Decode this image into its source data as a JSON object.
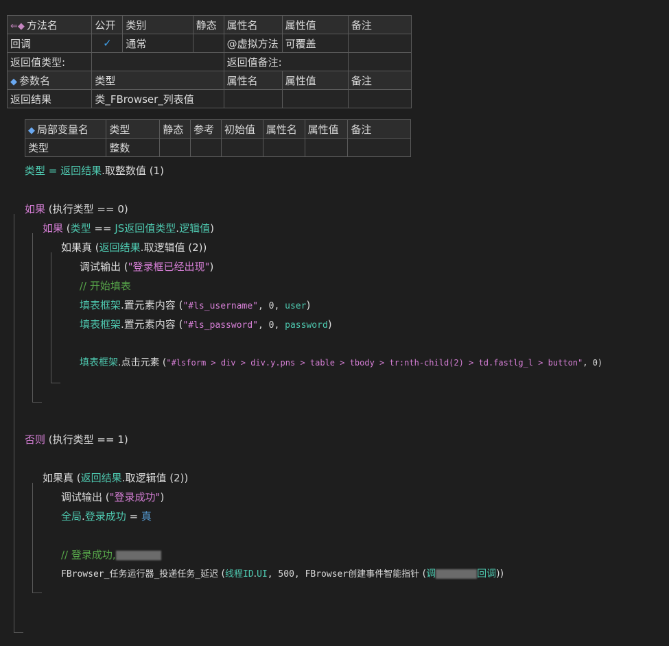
{
  "method_table": {
    "headers": [
      "方法名",
      "公开",
      "类别",
      "静态",
      "属性名",
      "属性值",
      "备注"
    ],
    "row": {
      "name": "回调",
      "public_check": "✓",
      "category": "通常",
      "attr_name": "@虚拟方法",
      "attr_value": "可覆盖"
    },
    "return_type_label": "返回值类型:",
    "return_note_label": "返回值备注:",
    "param_headers": [
      "参数名",
      "类型",
      "属性名",
      "属性值",
      "备注"
    ],
    "param_row": {
      "name": "返回结果",
      "type": "类_FBrowser_列表值"
    }
  },
  "local_table": {
    "headers": [
      "局部变量名",
      "类型",
      "静态",
      "参考",
      "初始值",
      "属性名",
      "属性值",
      "备注"
    ],
    "row": {
      "name": "类型",
      "type": "整数"
    }
  },
  "code": {
    "l1": [
      "类型",
      " = ",
      "返回结果",
      ".",
      "取整数值",
      " (1)"
    ],
    "l2": [
      "如果",
      " (",
      "执行类型",
      " == 0)"
    ],
    "l3": [
      "如果",
      " (",
      "类型",
      " == ",
      "JS返回值类型",
      ".",
      "逻辑值",
      ")"
    ],
    "l4": [
      "如果真",
      " (",
      "返回结果",
      ".",
      "取逻辑值",
      " (2))"
    ],
    "l5": [
      "调试输出",
      " (",
      "\"登录框已经出现\"",
      ")"
    ],
    "l6": "// 开始填表",
    "l7": [
      "填表框架",
      ".",
      "置元素内容",
      " (",
      "\"#ls_username\"",
      ", 0, ",
      "user",
      ")"
    ],
    "l8": [
      "填表框架",
      ".",
      "置元素内容",
      " (",
      "\"#ls_password\"",
      ", 0, ",
      "password",
      ")"
    ],
    "l9": [
      "填表框架",
      ".",
      "点击元素",
      " (",
      "\"#lsform > div > div.y.pns > table > tbody > tr:nth-child(2) > td.fastlg_l > button\"",
      ", 0)"
    ],
    "l10": [
      "否则",
      " (",
      "执行类型",
      " == 1)"
    ],
    "l11": [
      "如果真",
      " (",
      "返回结果",
      ".",
      "取逻辑值",
      " (2))"
    ],
    "l12": [
      "调试输出",
      " (",
      "\"登录成功\"",
      ")"
    ],
    "l13": [
      "全局",
      ".",
      "登录成功",
      " = ",
      "真"
    ],
    "l14": "// 登录成功,",
    "l15": [
      "FBrowser_任务运行器_投递任务_延迟",
      " (",
      "线程ID",
      ".",
      "UI",
      ", 500, ",
      "FBrowser创建事件智能指针",
      " (",
      "调",
      "回调",
      "))"
    ]
  }
}
